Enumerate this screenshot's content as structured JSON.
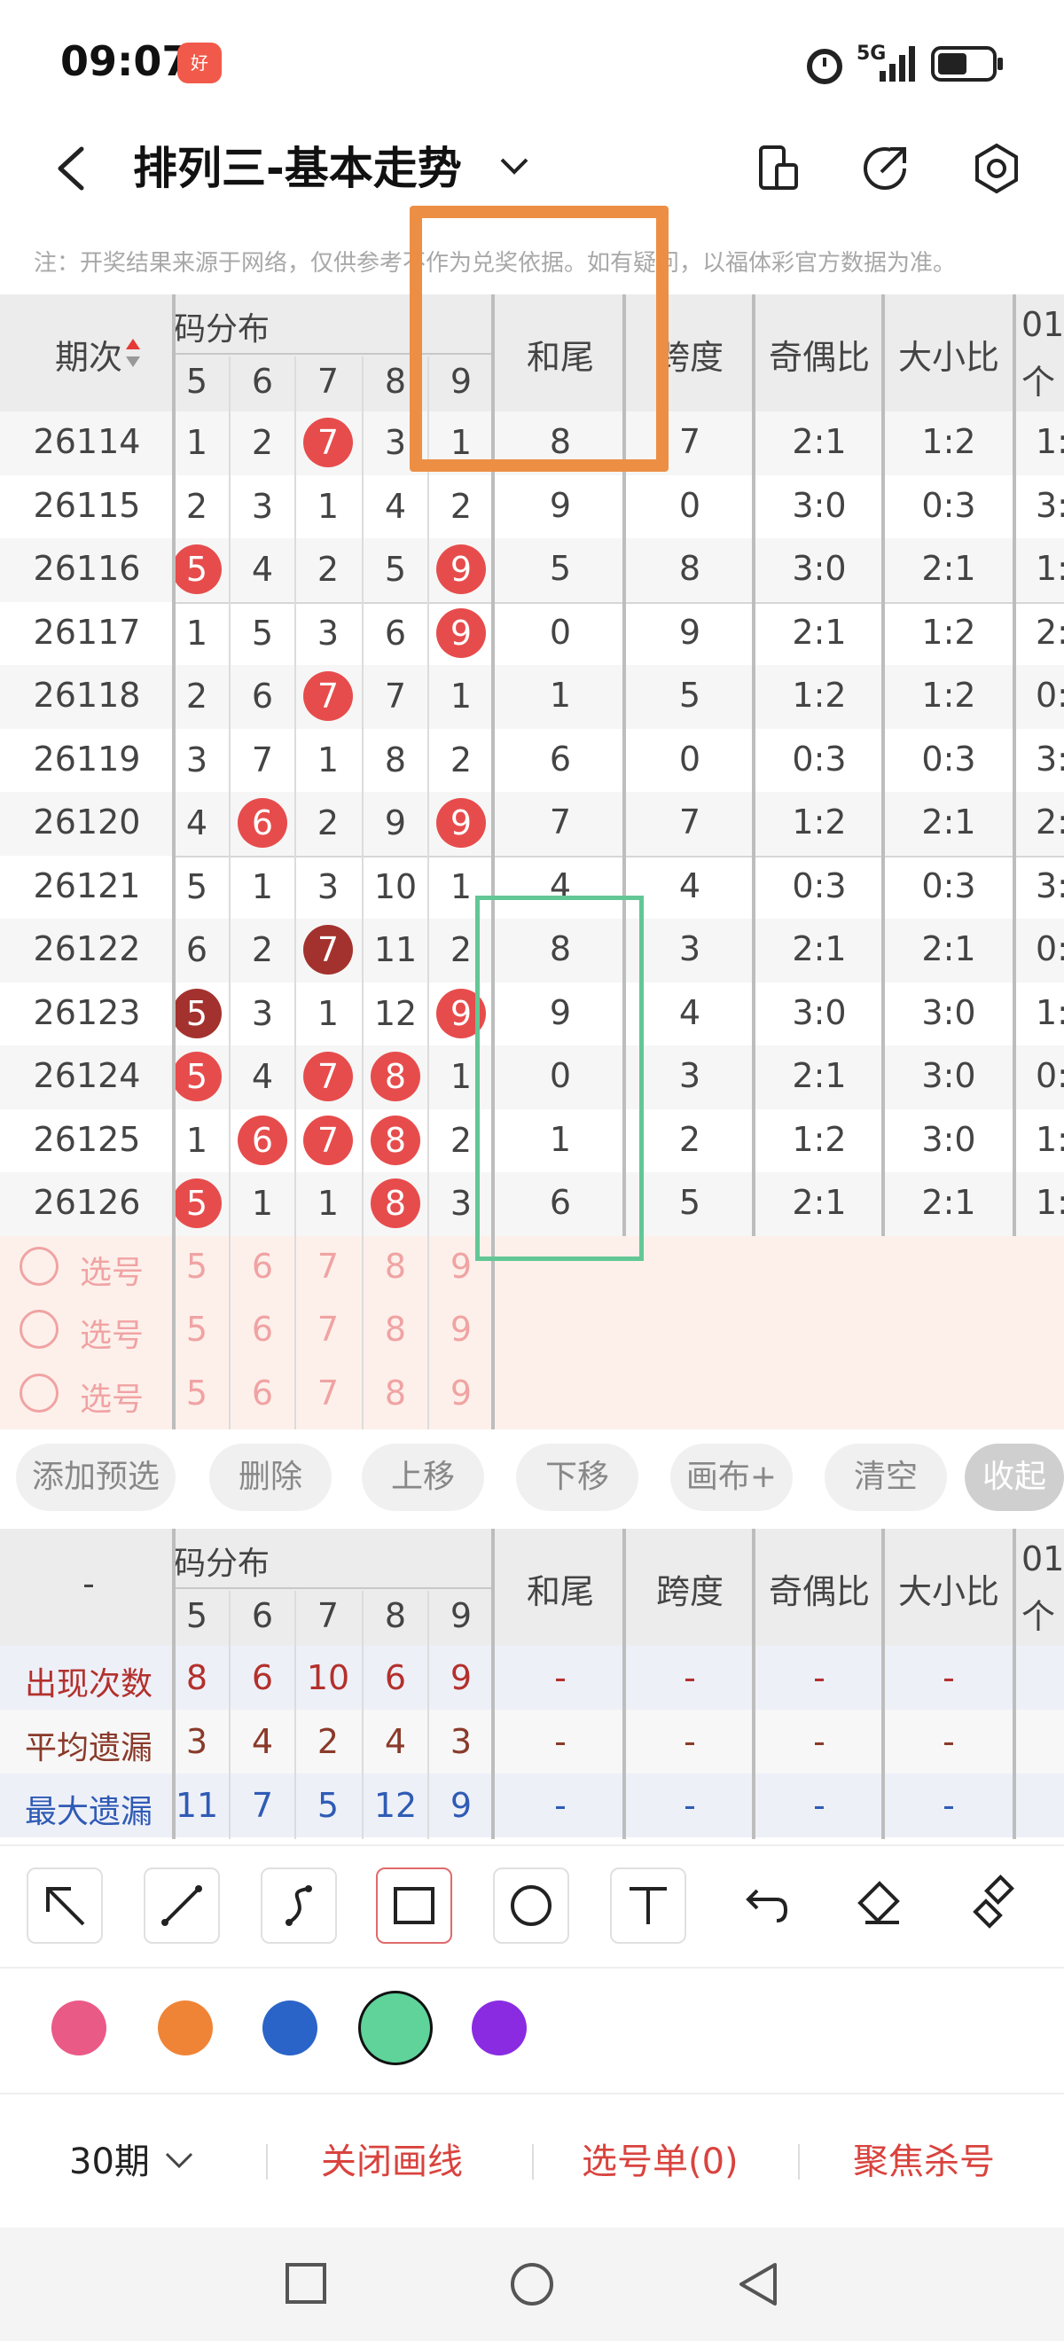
{
  "status_bar": {
    "time": "09:07",
    "network": "5G",
    "app_badge": "好"
  },
  "header": {
    "title": "排列三-基本走势"
  },
  "notice": "注：开奖结果来源于网络，仅供参考不作为兑奖依据。如有疑问，以福体彩官方数据为准。",
  "table": {
    "col_period": "期次",
    "group_label": "码分布",
    "digits": [
      "5",
      "6",
      "7",
      "8",
      "9"
    ],
    "col_hewei": "和尾",
    "col_kuadu": "跨度",
    "col_jiou": "奇偶比",
    "col_daxiao": "大小比",
    "col_extra_top": "01",
    "col_extra_bottom": "个",
    "rows": [
      {
        "period": "26114",
        "d": [
          "1",
          "2",
          "7",
          "3",
          "1"
        ],
        "hit": [
          0,
          0,
          1,
          0,
          0
        ],
        "hw": "8",
        "kd": "7",
        "jo": "2:1",
        "dx": "1:2",
        "ex": "1:"
      },
      {
        "period": "26115",
        "d": [
          "2",
          "3",
          "1",
          "4",
          "2"
        ],
        "hit": [
          0,
          0,
          0,
          0,
          0
        ],
        "hw": "9",
        "kd": "0",
        "jo": "3:0",
        "dx": "0:3",
        "ex": "3:"
      },
      {
        "period": "26116",
        "d": [
          "5",
          "4",
          "2",
          "5",
          "9"
        ],
        "hit": [
          1,
          0,
          0,
          0,
          1
        ],
        "hw": "5",
        "kd": "8",
        "jo": "3:0",
        "dx": "2:1",
        "ex": "1:"
      },
      {
        "period": "26117",
        "d": [
          "1",
          "5",
          "3",
          "6",
          "9"
        ],
        "hit": [
          0,
          0,
          0,
          0,
          1
        ],
        "hw": "0",
        "kd": "9",
        "jo": "2:1",
        "dx": "1:2",
        "ex": "2:"
      },
      {
        "period": "26118",
        "d": [
          "2",
          "6",
          "7",
          "7",
          "1"
        ],
        "hit": [
          0,
          0,
          1,
          0,
          0
        ],
        "hw": "1",
        "kd": "5",
        "jo": "1:2",
        "dx": "1:2",
        "ex": "0:"
      },
      {
        "period": "26119",
        "d": [
          "3",
          "7",
          "1",
          "8",
          "2"
        ],
        "hit": [
          0,
          0,
          0,
          0,
          0
        ],
        "hw": "6",
        "kd": "0",
        "jo": "0:3",
        "dx": "0:3",
        "ex": "3:"
      },
      {
        "period": "26120",
        "d": [
          "4",
          "6",
          "2",
          "9",
          "9"
        ],
        "hit": [
          0,
          1,
          0,
          0,
          1
        ],
        "hw": "7",
        "kd": "7",
        "jo": "1:2",
        "dx": "2:1",
        "ex": "2:"
      },
      {
        "period": "26121",
        "d": [
          "5",
          "1",
          "3",
          "10",
          "1"
        ],
        "hit": [
          0,
          0,
          0,
          0,
          0
        ],
        "hw": "4",
        "kd": "4",
        "jo": "0:3",
        "dx": "0:3",
        "ex": "3:"
      },
      {
        "period": "26122",
        "d": [
          "6",
          "2",
          "7",
          "11",
          "2"
        ],
        "hit": [
          0,
          0,
          2,
          0,
          0
        ],
        "hw": "8",
        "kd": "3",
        "jo": "2:1",
        "dx": "2:1",
        "ex": "0:"
      },
      {
        "period": "26123",
        "d": [
          "5",
          "3",
          "1",
          "12",
          "9"
        ],
        "hit": [
          2,
          0,
          0,
          0,
          1
        ],
        "hw": "9",
        "kd": "4",
        "jo": "3:0",
        "dx": "3:0",
        "ex": "1:"
      },
      {
        "period": "26124",
        "d": [
          "5",
          "4",
          "7",
          "8",
          "1"
        ],
        "hit": [
          1,
          0,
          1,
          1,
          0
        ],
        "hw": "0",
        "kd": "3",
        "jo": "2:1",
        "dx": "3:0",
        "ex": "0:"
      },
      {
        "period": "26125",
        "d": [
          "1",
          "6",
          "7",
          "8",
          "2"
        ],
        "hit": [
          0,
          1,
          1,
          1,
          0
        ],
        "hw": "1",
        "kd": "2",
        "jo": "1:2",
        "dx": "3:0",
        "ex": "1:"
      },
      {
        "period": "26126",
        "d": [
          "5",
          "1",
          "1",
          "8",
          "3"
        ],
        "hit": [
          1,
          0,
          0,
          1,
          0
        ],
        "hw": "6",
        "kd": "5",
        "jo": "2:1",
        "dx": "2:1",
        "ex": "1:"
      }
    ],
    "select_label": "选号",
    "select_digits": [
      "5",
      "6",
      "7",
      "8",
      "9"
    ]
  },
  "actions": [
    "添加预选",
    "删除",
    "上移",
    "下移",
    "画布+",
    "清空",
    "收起"
  ],
  "stats": {
    "corner": "-",
    "rows": [
      {
        "label": "出现次数",
        "vals": [
          "8",
          "6",
          "10",
          "6",
          "9"
        ],
        "dash": "-",
        "color": "#b3302c"
      },
      {
        "label": "平均遗漏",
        "vals": [
          "3",
          "4",
          "2",
          "4",
          "3"
        ],
        "dash": "-",
        "color": "#8a3a2a"
      },
      {
        "label": "最大遗漏",
        "vals": [
          "11",
          "7",
          "5",
          "12",
          "9"
        ],
        "dash": "-",
        "color": "#2f5bb5"
      }
    ]
  },
  "drawing_tools": [
    "arrow-icon",
    "line-icon",
    "curve-icon",
    "rectangle-icon",
    "circle-icon",
    "text-icon",
    "undo-icon",
    "eraser-icon",
    "clear-brush-icon"
  ],
  "palette": [
    "#ea5a86",
    "#f08436",
    "#2a64c8",
    "#5fd39a",
    "#8a2be2"
  ],
  "bottom": {
    "period_select": "30期",
    "close_draw": "关闭画线",
    "pick_list": "选号单(0)",
    "focus_kill": "聚焦杀号"
  }
}
